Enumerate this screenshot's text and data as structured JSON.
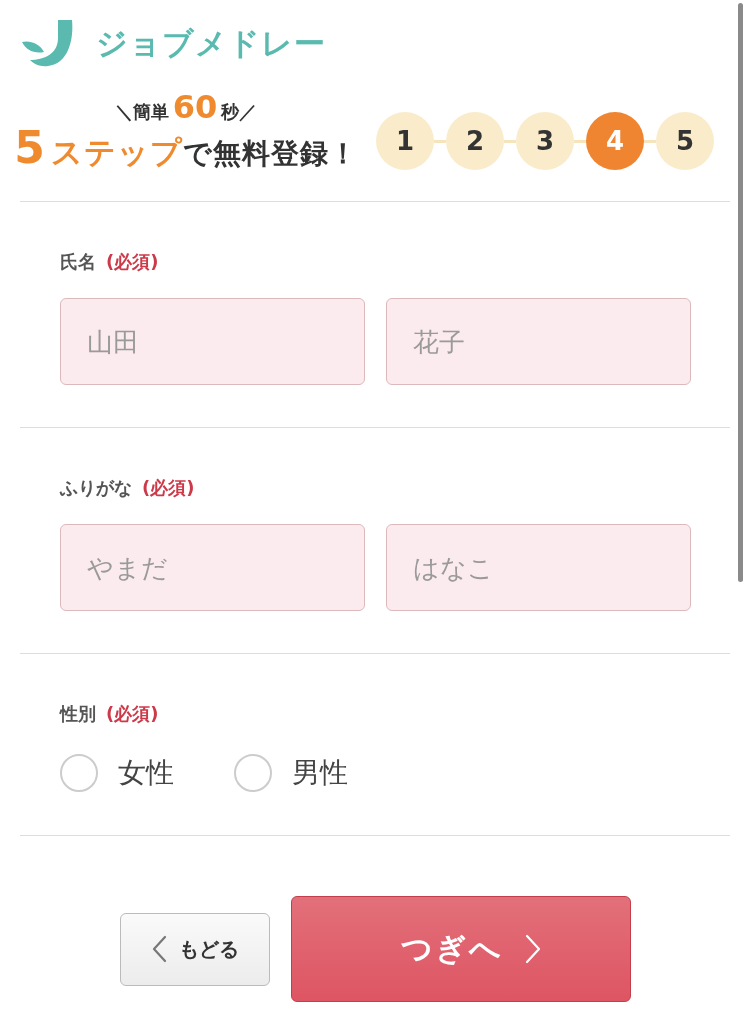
{
  "header": {
    "logo_text": "ジョブメドレー"
  },
  "promo": {
    "tagline": [
      {
        "kind": "plain",
        "text": "＼簡単"
      },
      {
        "kind": "accent",
        "text": "60"
      },
      {
        "kind": "plain",
        "text": "秒／"
      }
    ],
    "headline": [
      {
        "kind": "number",
        "text": "5"
      },
      {
        "kind": "accent",
        "text": "ステップ"
      },
      {
        "kind": "plain",
        "text": "で無料登録！"
      }
    ]
  },
  "steps": [
    {
      "label": "1",
      "selected": false
    },
    {
      "label": "2",
      "selected": false
    },
    {
      "label": "3",
      "selected": false
    },
    {
      "label": "4",
      "selected": true
    },
    {
      "label": "5",
      "selected": false
    }
  ],
  "fields": [
    {
      "kind": "text",
      "label": "氏名",
      "required_note": "(必須)",
      "inputs": [
        {
          "placeholder": "山田"
        },
        {
          "placeholder": "花子"
        }
      ]
    },
    {
      "kind": "text",
      "label": "ふりがな",
      "required_note": "(必須)",
      "inputs": [
        {
          "placeholder": "やまだ"
        },
        {
          "placeholder": "はなこ"
        }
      ]
    },
    {
      "kind": "radio",
      "label": "性別",
      "required_note": "(必須)",
      "options": [
        {
          "label": "女性",
          "selected": false
        },
        {
          "label": "男性",
          "selected": false
        }
      ]
    }
  ],
  "buttons": {
    "back": "もどる",
    "next": "つぎへ"
  }
}
